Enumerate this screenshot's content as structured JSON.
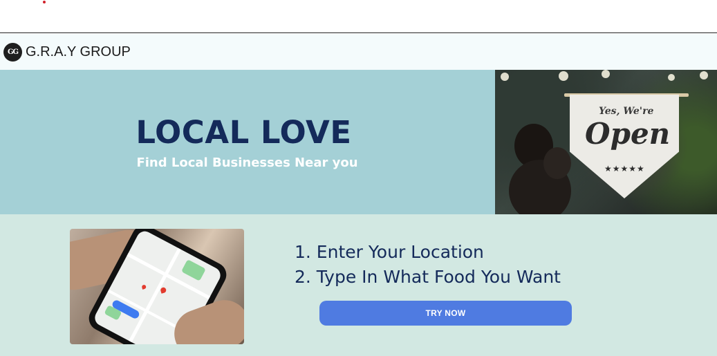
{
  "navbar": {
    "logo_initials": "GG",
    "brand": "G.R.A.Y GROUP"
  },
  "hero": {
    "title": "LOCAL LOVE",
    "subtitle": "Find Local Businesses Near you",
    "sign_small": "Yes, We're",
    "sign_big": "Open",
    "sign_stars": "★★★★★"
  },
  "steps": {
    "step_1": "1. Enter Your Location",
    "step_2": "2. Type In What Food You Want",
    "cta_label": "TRY NOW"
  },
  "colors": {
    "hero_bg": "#a4d0d6",
    "title_navy": "#142a5a",
    "steps_bg": "#d2e8e2",
    "button_blue": "#4f7be1"
  }
}
